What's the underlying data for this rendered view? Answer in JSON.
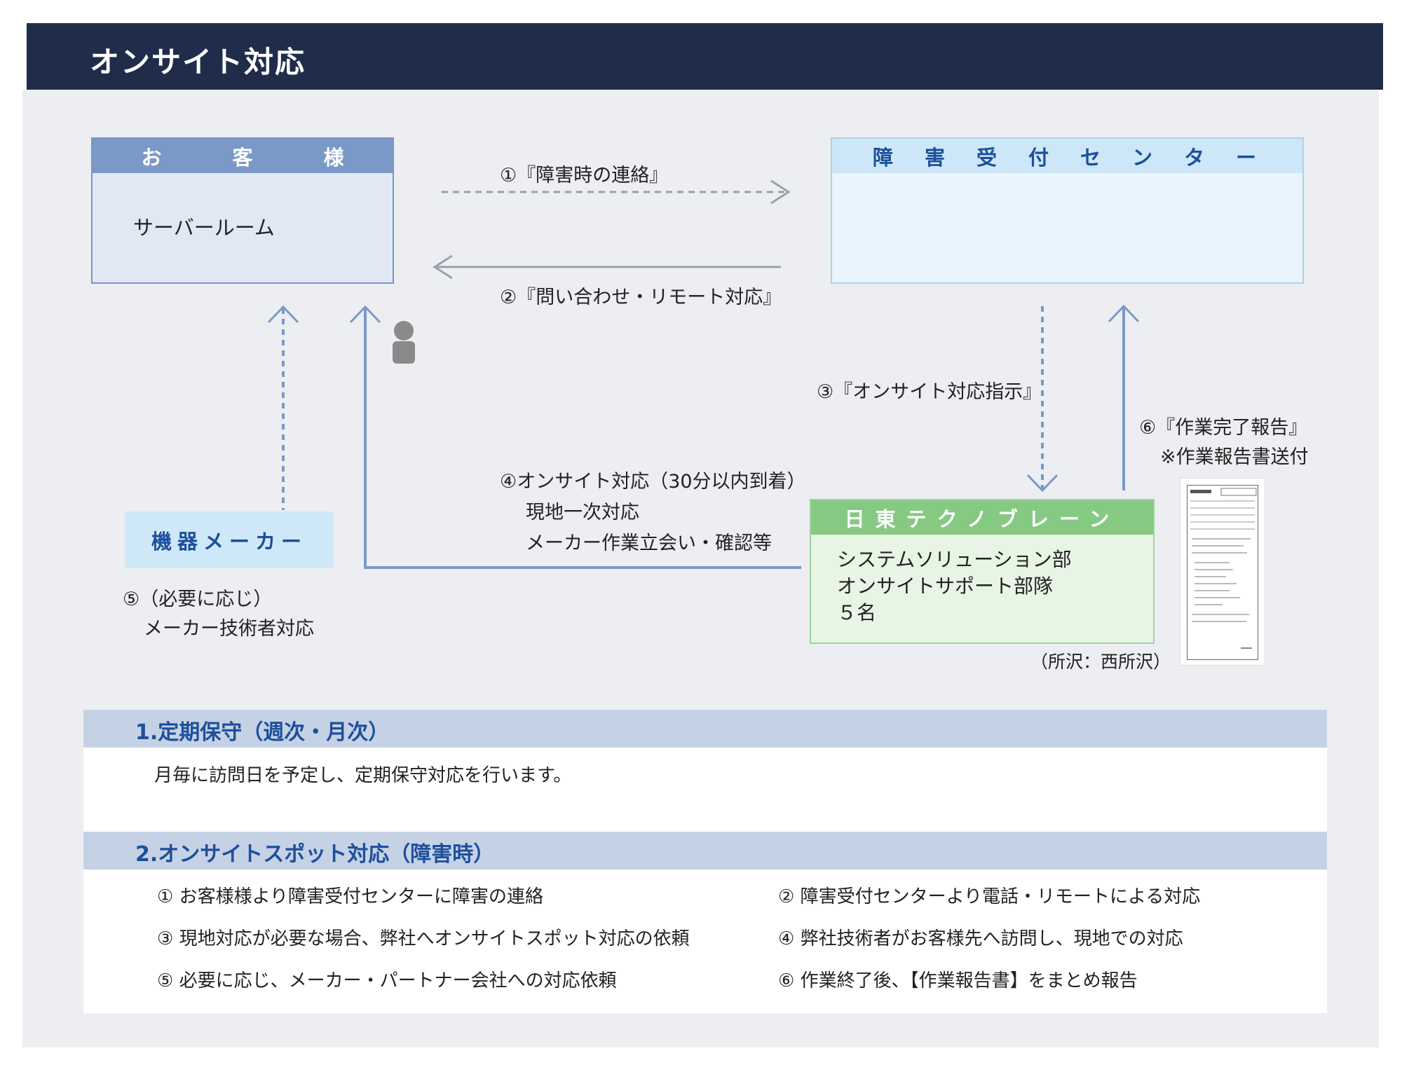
{
  "header": {
    "title": "オンサイト対応"
  },
  "diagram": {
    "customer": {
      "title": "お　客　様",
      "room": "サーバールーム"
    },
    "reception_center": {
      "title": "障　害　受　付　セ　ン　タ　ー"
    },
    "maker": {
      "title": "機器メーカー"
    },
    "nitto": {
      "title": "日東テクノブレーン",
      "lines": [
        "システムソリューション部",
        "オンサイトサポート部隊",
        "５名"
      ],
      "location": "（所沢：西所沢）"
    },
    "labels": {
      "step1": "①『障害時の連絡』",
      "step2": "②『問い合わせ・リモート対応』",
      "step3": "③『オンサイト対応指示』",
      "step4": [
        "④オンサイト対応（30分以内到着）",
        "現地一次対応",
        "メーカー作業立会い・確認等"
      ],
      "step5": [
        "⑤（必要に応じ）",
        "メーカー技術者対応"
      ],
      "step6": [
        "⑥『作業完了報告』",
        "※作業報告書送付"
      ]
    },
    "colors": {
      "navy": "#1f2d4a",
      "blue": "#7b99c7",
      "person_blue": "#2f8fe0",
      "person_gray": "#8a8a8a",
      "green": "#86c983"
    }
  },
  "sections": [
    {
      "title": "1.定期保守（週次・月次）",
      "text": "月毎に訪問日を予定し、定期保守対応を行います。"
    },
    {
      "title": "2.オンサイトスポット対応（障害時）",
      "items": [
        "① お客様様より障害受付センターに障害の連絡",
        "② 障害受付センターより電話・リモートによる対応",
        "③ 現地対応が必要な場合、弊社へオンサイトスポット対応の依頼",
        "④ 弊社技術者がお客様先へ訪問し、現地での対応",
        "⑤ 必要に応じ、メーカー・パートナー会社への対応依頼",
        "⑥ 作業終了後、【作業報告書】をまとめ報告"
      ]
    }
  ]
}
